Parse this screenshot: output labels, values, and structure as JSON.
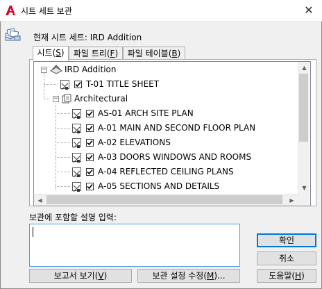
{
  "window": {
    "title": "시트 세트 보관",
    "close_glyph": "✕"
  },
  "header": {
    "current_sheet_set": "현재 시트 세트: IRD Addition"
  },
  "tabs": [
    {
      "label": "시트(",
      "key": "S",
      "suffix": ")"
    },
    {
      "label": "파일 트리(",
      "key": "F",
      "suffix": ")"
    },
    {
      "label": "파일 테이블(",
      "key": "B",
      "suffix": ")"
    }
  ],
  "tree": {
    "root": "IRD Addition",
    "title_sheet": "T-01 TITLE SHEET",
    "subset": "Architectural",
    "sheets": [
      "AS-01 ARCH SITE PLAN",
      "A-01 MAIN AND SECOND FLOOR PLAN",
      "A-02 ELEVATIONS",
      "A-03 DOORS WINDOWS AND ROOMS",
      "A-04 REFLECTED CEILING PLANS",
      "A-05 SECTIONS AND DETAILS"
    ],
    "all_checked": true
  },
  "description": {
    "label": "보관에 포함할 설명 입력:",
    "value": ""
  },
  "buttons": {
    "view_report": {
      "label": "보고서 보기(",
      "key": "V",
      "suffix": ")"
    },
    "modify_settings": {
      "label": "보관 설정 수정(",
      "key": "M",
      "suffix": ")..."
    },
    "ok": "확인",
    "cancel": "취소",
    "help": {
      "label": "도움말(",
      "key": "H",
      "suffix": ")"
    }
  },
  "icons": {
    "app": "autocad-red-a-icon",
    "header": "archive-package-icon",
    "sheet_set": "sheet-set-icon",
    "subset": "subset-folder-icon",
    "sheet": "sheet-layout-icon"
  },
  "colors": {
    "app_red": "#c8102e",
    "focus_blue": "#0078d7",
    "dialog_bg": "#f0f0f0"
  }
}
